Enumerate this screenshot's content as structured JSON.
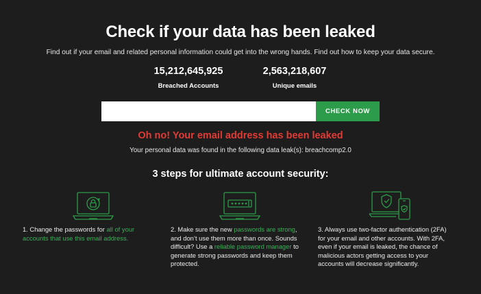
{
  "header": {
    "title": "Check if your data has been leaked",
    "subtitle": "Find out if your email and related personal information could get into the wrong hands. Find out how to keep your data secure."
  },
  "stats": [
    {
      "value": "15,212,645,925",
      "label": "Breached Accounts"
    },
    {
      "value": "2,563,218,607",
      "label": "Unique emails"
    }
  ],
  "search": {
    "value": "",
    "placeholder": "",
    "button_label": "CHECK NOW"
  },
  "result": {
    "alert": "Oh no! Your email address has been leaked",
    "detail": "Your personal data was found in the following data leak(s): breachcomp2.0"
  },
  "steps_section": {
    "title": "3 steps for ultimate account security:",
    "steps": [
      {
        "icon": "laptop-lock-refresh-icon",
        "pre": "1. Change the passwords for ",
        "link": "all of your accounts that use this email address.",
        "post": ""
      },
      {
        "icon": "laptop-password-icon",
        "pre": "2. Make sure the new ",
        "link": "passwords are strong",
        "mid": ", and don’t use them more than once. Sounds difficult? Use a ",
        "link2": "reliable password manager",
        "post": " to generate strong passwords and keep them protected."
      },
      {
        "icon": "laptop-phone-shield-icon",
        "text": "3. Always use two-factor authentication (2FA) for your email and other accounts. With 2FA, even if your email is leaked, the chance of malicious actors getting access to your accounts will decrease significantly."
      }
    ]
  },
  "colors": {
    "background": "#1d1d1d",
    "accent_green": "#2d9c4a",
    "link_green": "#3bb05a",
    "alert_red": "#e23b35"
  }
}
